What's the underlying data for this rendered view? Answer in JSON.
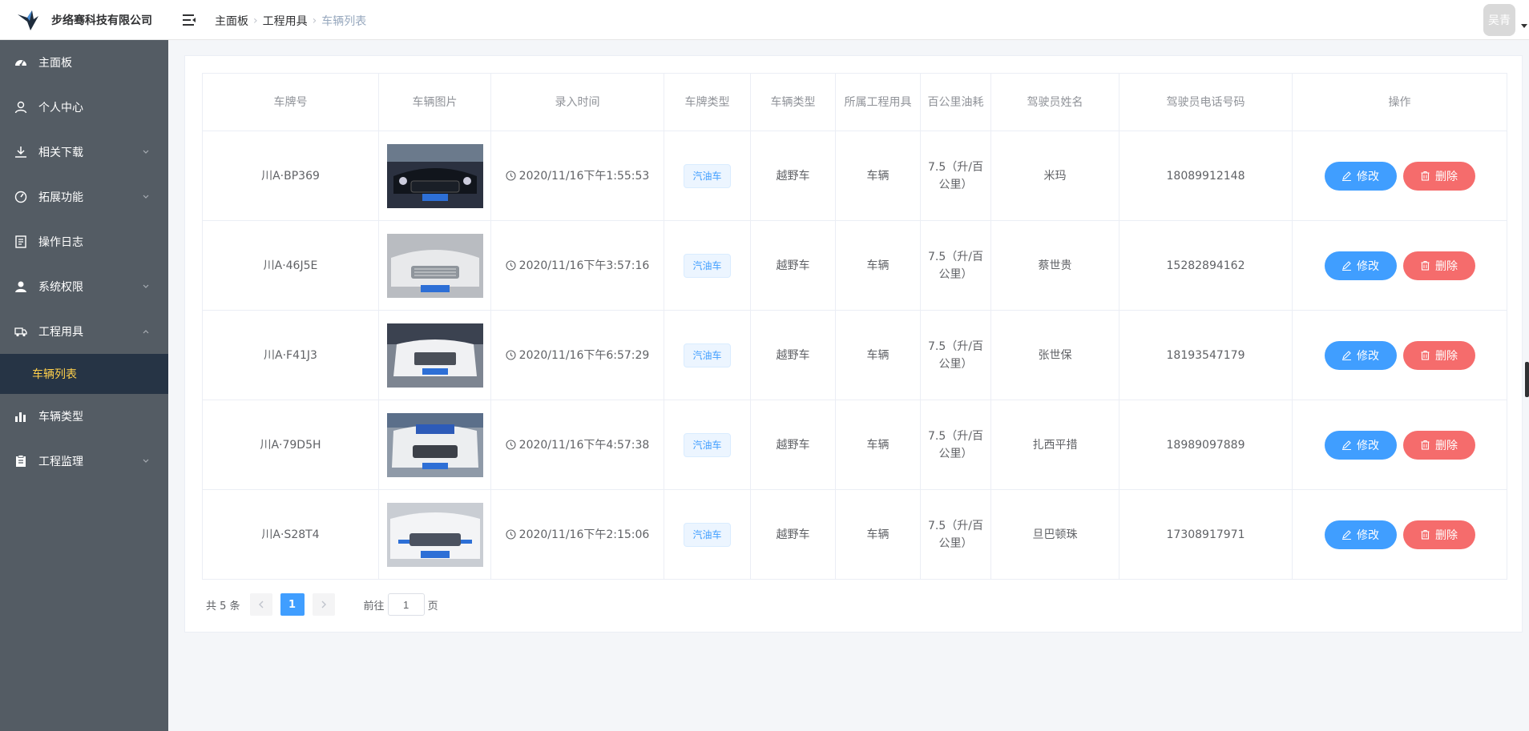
{
  "header": {
    "company": "步络骞科技有限公司",
    "breadcrumb": [
      "主面板",
      "工程用具",
      "车辆列表"
    ],
    "user": "吴青"
  },
  "sidebar": {
    "items": [
      {
        "label": "主面板",
        "icon": "dashboard-icon"
      },
      {
        "label": "个人中心",
        "icon": "user-icon"
      },
      {
        "label": "相关下载",
        "icon": "download-icon"
      },
      {
        "label": "拓展功能",
        "icon": "gauge-icon"
      },
      {
        "label": "操作日志",
        "icon": "document-icon"
      },
      {
        "label": "系统权限",
        "icon": "person-icon"
      },
      {
        "label": "工程用具",
        "icon": "truck-icon"
      },
      {
        "label": "车辆类型",
        "icon": "bar-chart-icon"
      },
      {
        "label": "工程监理",
        "icon": "clipboard-icon"
      }
    ],
    "active_sub": "车辆列表"
  },
  "table": {
    "columns": [
      "车牌号",
      "车辆图片",
      "录入时间",
      "车牌类型",
      "车辆类型",
      "所属工程用具",
      "百公里油耗",
      "驾驶员姓名",
      "驾驶员电话号码",
      "操作"
    ],
    "rows": [
      {
        "plate": "川A·BP369",
        "time": "2020/11/16下午1:55:53",
        "plate_type": "汽油车",
        "vehicle_type": "越野车",
        "tool": "车辆",
        "fuel": "7.5（升/百公里）",
        "driver": "米玛",
        "phone": "18089912148"
      },
      {
        "plate": "川A·46J5E",
        "time": "2020/11/16下午3:57:16",
        "plate_type": "汽油车",
        "vehicle_type": "越野车",
        "tool": "车辆",
        "fuel": "7.5（升/百公里）",
        "driver": "蔡世贵",
        "phone": "15282894162"
      },
      {
        "plate": "川A·F41J3",
        "time": "2020/11/16下午6:57:29",
        "plate_type": "汽油车",
        "vehicle_type": "越野车",
        "tool": "车辆",
        "fuel": "7.5（升/百公里）",
        "driver": "张世保",
        "phone": "18193547179"
      },
      {
        "plate": "川A·79D5H",
        "time": "2020/11/16下午4:57:38",
        "plate_type": "汽油车",
        "vehicle_type": "越野车",
        "tool": "车辆",
        "fuel": "7.5（升/百公里）",
        "driver": "扎西平措",
        "phone": "18989097889"
      },
      {
        "plate": "川A·S28T4",
        "time": "2020/11/16下午2:15:06",
        "plate_type": "汽油车",
        "vehicle_type": "越野车",
        "tool": "车辆",
        "fuel": "7.5（升/百公里）",
        "driver": "旦巴顿珠",
        "phone": "17308917971"
      }
    ],
    "edit_label": "修改",
    "delete_label": "删除"
  },
  "pagination": {
    "total": "共 5 条",
    "current": "1",
    "goto_prefix": "前往",
    "goto_value": "1",
    "goto_suffix": "页"
  },
  "colors": {
    "sidebar_bg": "#545c64",
    "sidebar_active_bg": "#263445",
    "sidebar_active_text": "#ffd04b",
    "primary": "#409eff",
    "danger": "#f56c6c"
  }
}
